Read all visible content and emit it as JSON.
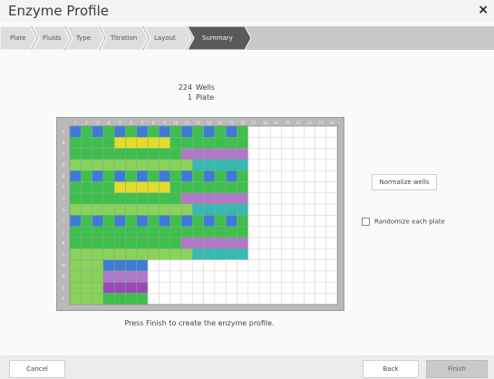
{
  "window": {
    "title": "Enzyme Profile",
    "close_glyph": "×"
  },
  "steps": [
    {
      "label": "Plate",
      "active": false
    },
    {
      "label": "Fluids",
      "active": false
    },
    {
      "label": "Type",
      "active": false
    },
    {
      "label": "Titration",
      "active": false
    },
    {
      "label": "Layout",
      "active": false
    },
    {
      "label": "Summary",
      "active": true
    }
  ],
  "summary": {
    "wells_count": "224",
    "wells_label": "Wells",
    "plates_count": "1",
    "plates_label": "Plate"
  },
  "plate": {
    "columns": [
      "1",
      "2",
      "3",
      "4",
      "5",
      "6",
      "7",
      "8",
      "9",
      "10",
      "11",
      "12",
      "13",
      "14",
      "15",
      "16",
      "17",
      "18",
      "19",
      "20",
      "21",
      "22",
      "23",
      "24"
    ],
    "rows": [
      "A",
      "B",
      "C",
      "D",
      "E",
      "F",
      "G",
      "H",
      "I",
      "J",
      "K",
      "L",
      "M",
      "N",
      "O",
      "P"
    ],
    "rows_filled_columns": [
      16,
      16,
      16,
      16,
      16,
      16,
      16,
      16,
      16,
      16,
      16,
      16,
      7,
      7,
      7,
      7
    ],
    "palette": [
      "#3fbf4d",
      "#3f7ad6",
      "#e2dc2a",
      "#b277c9",
      "#36b9b0",
      "#9a47b8",
      "#8ad35a",
      "#6fc09c"
    ]
  },
  "actions": {
    "normalize_label": "Normalize wells",
    "randomize_label": "Randomize each plate",
    "randomize_checked": false
  },
  "message": "Press Finish to create the enzyme profile.",
  "footer": {
    "cancel": "Cancel",
    "back": "Back",
    "finish": "Finish"
  },
  "colors": {
    "step_active": "#5a5a5a",
    "step_bg": "#dedede",
    "finish_bg": "#c9c9c9"
  }
}
